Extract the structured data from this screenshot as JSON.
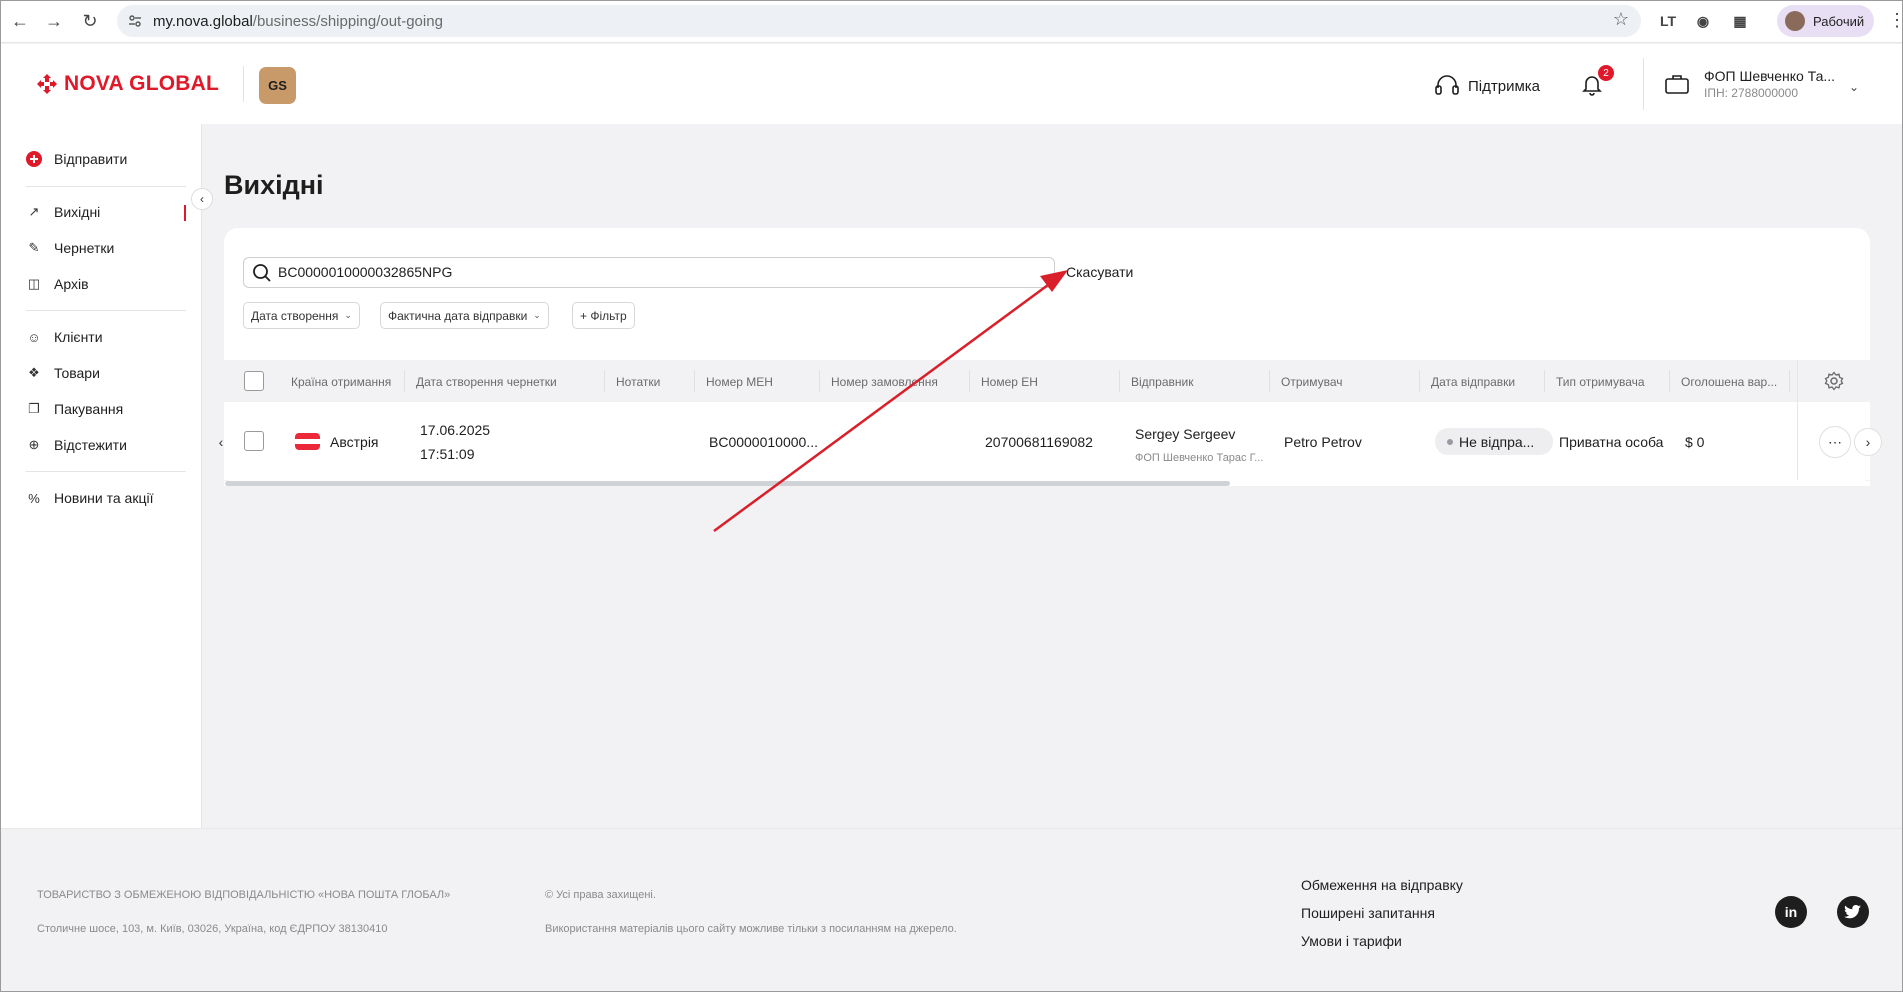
{
  "browser": {
    "url_host": "my.nova.global",
    "url_path": "/business/shipping/out-going",
    "profile_label": "Рабочий",
    "ext_label": "LT"
  },
  "header": {
    "logo_text": "NOVA GLOBAL",
    "badge_text": "GS",
    "support_label": "Підтримка",
    "notifications_count": "2",
    "account_name": "ФОП Шевченко Та...",
    "account_ipn": "ІПН: 2788000000"
  },
  "sidebar": {
    "send_label": "Відправити",
    "items_group1": [
      "Вихідні",
      "Чернетки",
      "Архів"
    ],
    "items_group2": [
      "Клієнти",
      "Товари",
      "Пакування",
      "Відстежити"
    ],
    "items_group3": [
      "Новини та акції"
    ],
    "active_item": "Вихідні"
  },
  "main": {
    "title": "Вихідні",
    "search_value": "BC0000010000032865NPG",
    "cancel_label": "Скасувати",
    "filters": [
      "Дата створення",
      "Фактична дата відправки",
      "+ Фільтр"
    ]
  },
  "table": {
    "columns": [
      "Країна отримання",
      "Дата створення чернетки",
      "Нотатки",
      "Номер МЕН",
      "Номер замовлення",
      "Номер ЕН",
      "Відправник",
      "Отримувач",
      "Дата відправки",
      "Тип отримувача",
      "Оголошена вар..."
    ],
    "row": {
      "country": "Австрія",
      "created_date": "17.06.2025",
      "created_time": "17:51:09",
      "men_number": "BC0000010000...",
      "en_number": "20700681169082",
      "sender_name": "Sergey Sergeev",
      "sender_company": "ФОП Шевченко Тарас Г...",
      "recipient": "Petro Petrov",
      "send_status": "Не відпра...",
      "recipient_type": "Приватна особа",
      "declared_value": "$ 0"
    }
  },
  "footer": {
    "company": "ТОВАРИСТВО З ОБМЕЖЕНОЮ ВІДПОВІДАЛЬНІСТЮ «НОВА ПОШТА ГЛОБАЛ»",
    "address": "Столичне шосе, 103, м. Київ, 03026, Україна, код ЄДРПОУ 38130410",
    "rights": "© Усі права захищені.",
    "usage_note": "Використання матеріалів цього сайту можливе тільки з посиланням на джерело.",
    "links": [
      "Обмеження на відправку",
      "Поширені запитання",
      "Умови і тарифи"
    ],
    "social": [
      "in",
      "t"
    ]
  },
  "colors": {
    "brand_red": "#e0192a",
    "annotation_arrow": "#d9202a",
    "austria_red": "#ed2939"
  }
}
